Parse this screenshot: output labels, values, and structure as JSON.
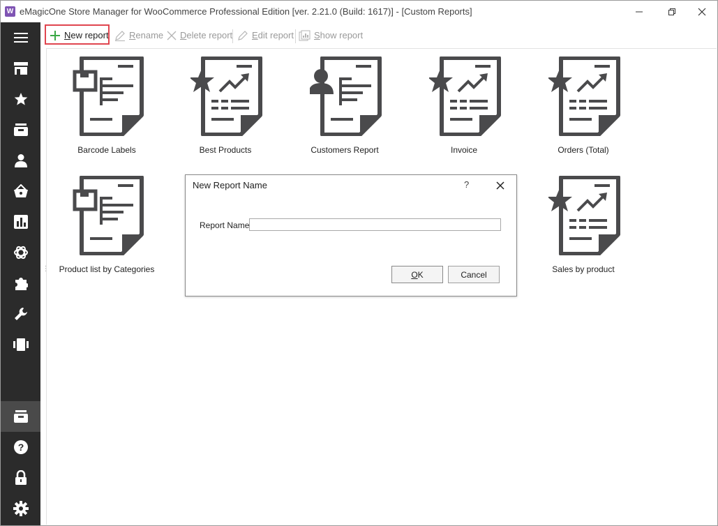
{
  "window": {
    "title": "eMagicOne Store Manager for WooCommerce Professional Edition [ver. 2.21.0 (Build: 1617)] - [Custom Reports]",
    "app_icon_glyph": "W"
  },
  "sidebar": {
    "items": [
      {
        "icon": "hamburger-menu-icon"
      },
      {
        "icon": "store-icon"
      },
      {
        "icon": "star-icon"
      },
      {
        "icon": "inbox-icon"
      },
      {
        "icon": "user-icon"
      },
      {
        "icon": "basket-icon"
      },
      {
        "icon": "bar-chart-icon"
      },
      {
        "icon": "openai-icon"
      },
      {
        "icon": "puzzle-icon"
      },
      {
        "icon": "wrench-icon"
      },
      {
        "icon": "carousel-icon"
      },
      {
        "icon": "custom-reports-icon",
        "active": true
      },
      {
        "icon": "help-icon"
      },
      {
        "icon": "lock-icon"
      },
      {
        "icon": "gear-icon"
      }
    ]
  },
  "toolbar": {
    "new_report_pre": "",
    "new_report_ul": "N",
    "new_report_post": "ew report",
    "rename_ul": "R",
    "rename_post": "ename",
    "delete_ul": "D",
    "delete_post": "elete report",
    "edit_ul": "E",
    "edit_post": "dit report",
    "show_ul": "S",
    "show_post": "how report"
  },
  "reports": [
    {
      "label": "Barcode Labels",
      "icon": "box-report-icon"
    },
    {
      "label": "Best Products",
      "icon": "star-chart-report-icon"
    },
    {
      "label": "Customers Report",
      "icon": "person-report-icon"
    },
    {
      "label": "Invoice",
      "icon": "star-chart-report-icon"
    },
    {
      "label": "Orders (Total)",
      "icon": "star-chart-report-icon"
    },
    {
      "label": "Product list by Categories",
      "icon": "box-report-icon"
    },
    {
      "label": "Sales by product",
      "icon": "star-chart-report-icon"
    }
  ],
  "dialog": {
    "title": "New Report Name",
    "help": "?",
    "field_label": "Report Name",
    "field_value": "",
    "ok_ul": "O",
    "ok_post": "K",
    "cancel_label": "Cancel"
  },
  "colors": {
    "sidebar_bg": "#2b2b2b",
    "icon_dark": "#4a4a4c",
    "highlight": "#e0454f",
    "add_green": "#3aa845"
  }
}
